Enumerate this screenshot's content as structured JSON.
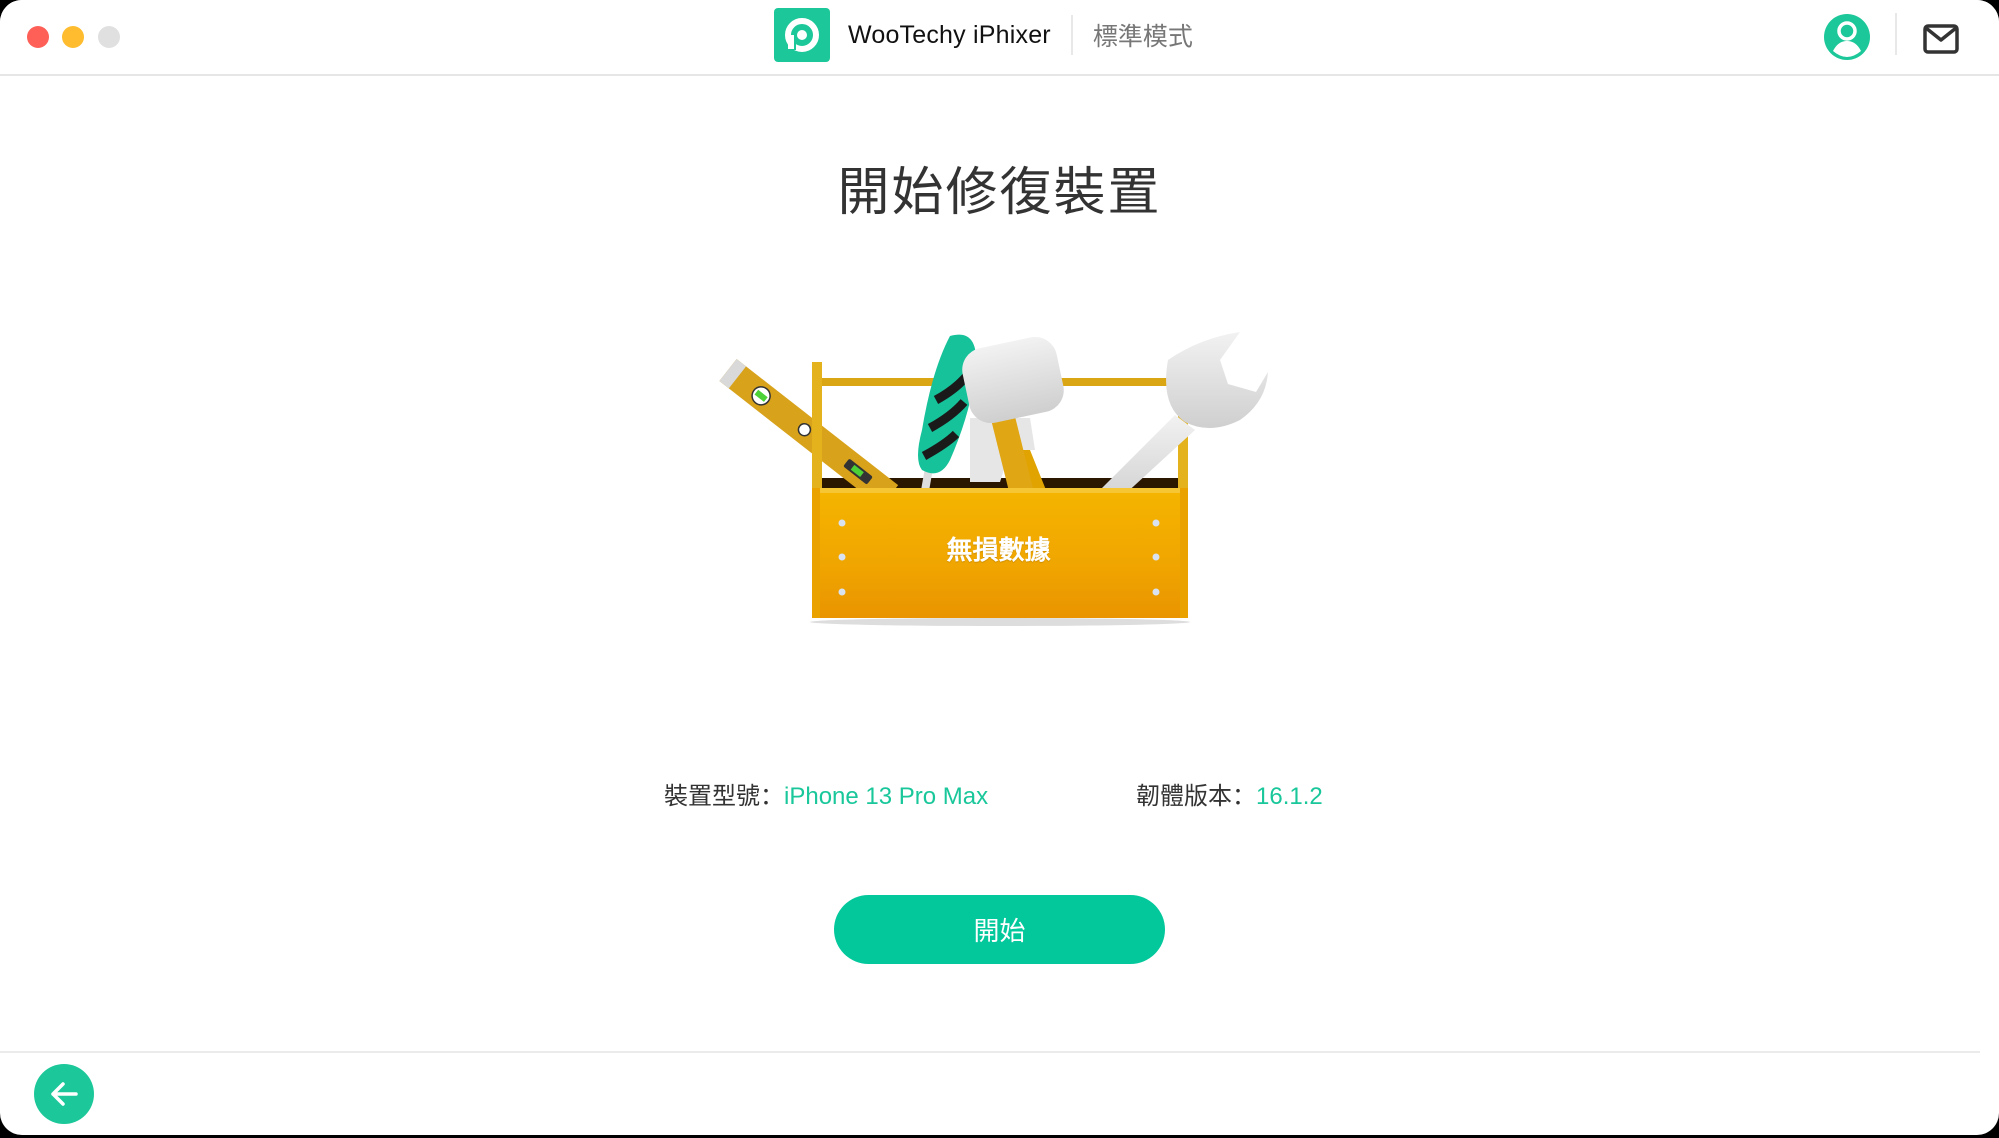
{
  "window": {
    "controls": [
      "close",
      "minimize",
      "maximize"
    ]
  },
  "header": {
    "app_name": "WooTechy iPhixer",
    "mode": "標準模式",
    "logo_icon": "p-logo-icon",
    "account_icon": "user-avatar-icon",
    "mail_icon": "mail-icon"
  },
  "main": {
    "title": "開始修復裝置",
    "illustration": {
      "label": "無損數據",
      "icon": "toolbox-icon"
    },
    "device": {
      "model_label": "裝置型號：",
      "model_value": "iPhone 13 Pro Max",
      "firmware_label": "韌體版本：",
      "firmware_value": "16.1.2"
    },
    "start_button": "開始"
  },
  "footer": {
    "back_icon": "arrow-left-icon"
  },
  "colors": {
    "accent": "#03c89c",
    "text_primary": "#333333",
    "text_secondary": "#777777",
    "close": "#fe5f57",
    "minimize": "#febc2e",
    "maximize": "#e0e0e0"
  }
}
